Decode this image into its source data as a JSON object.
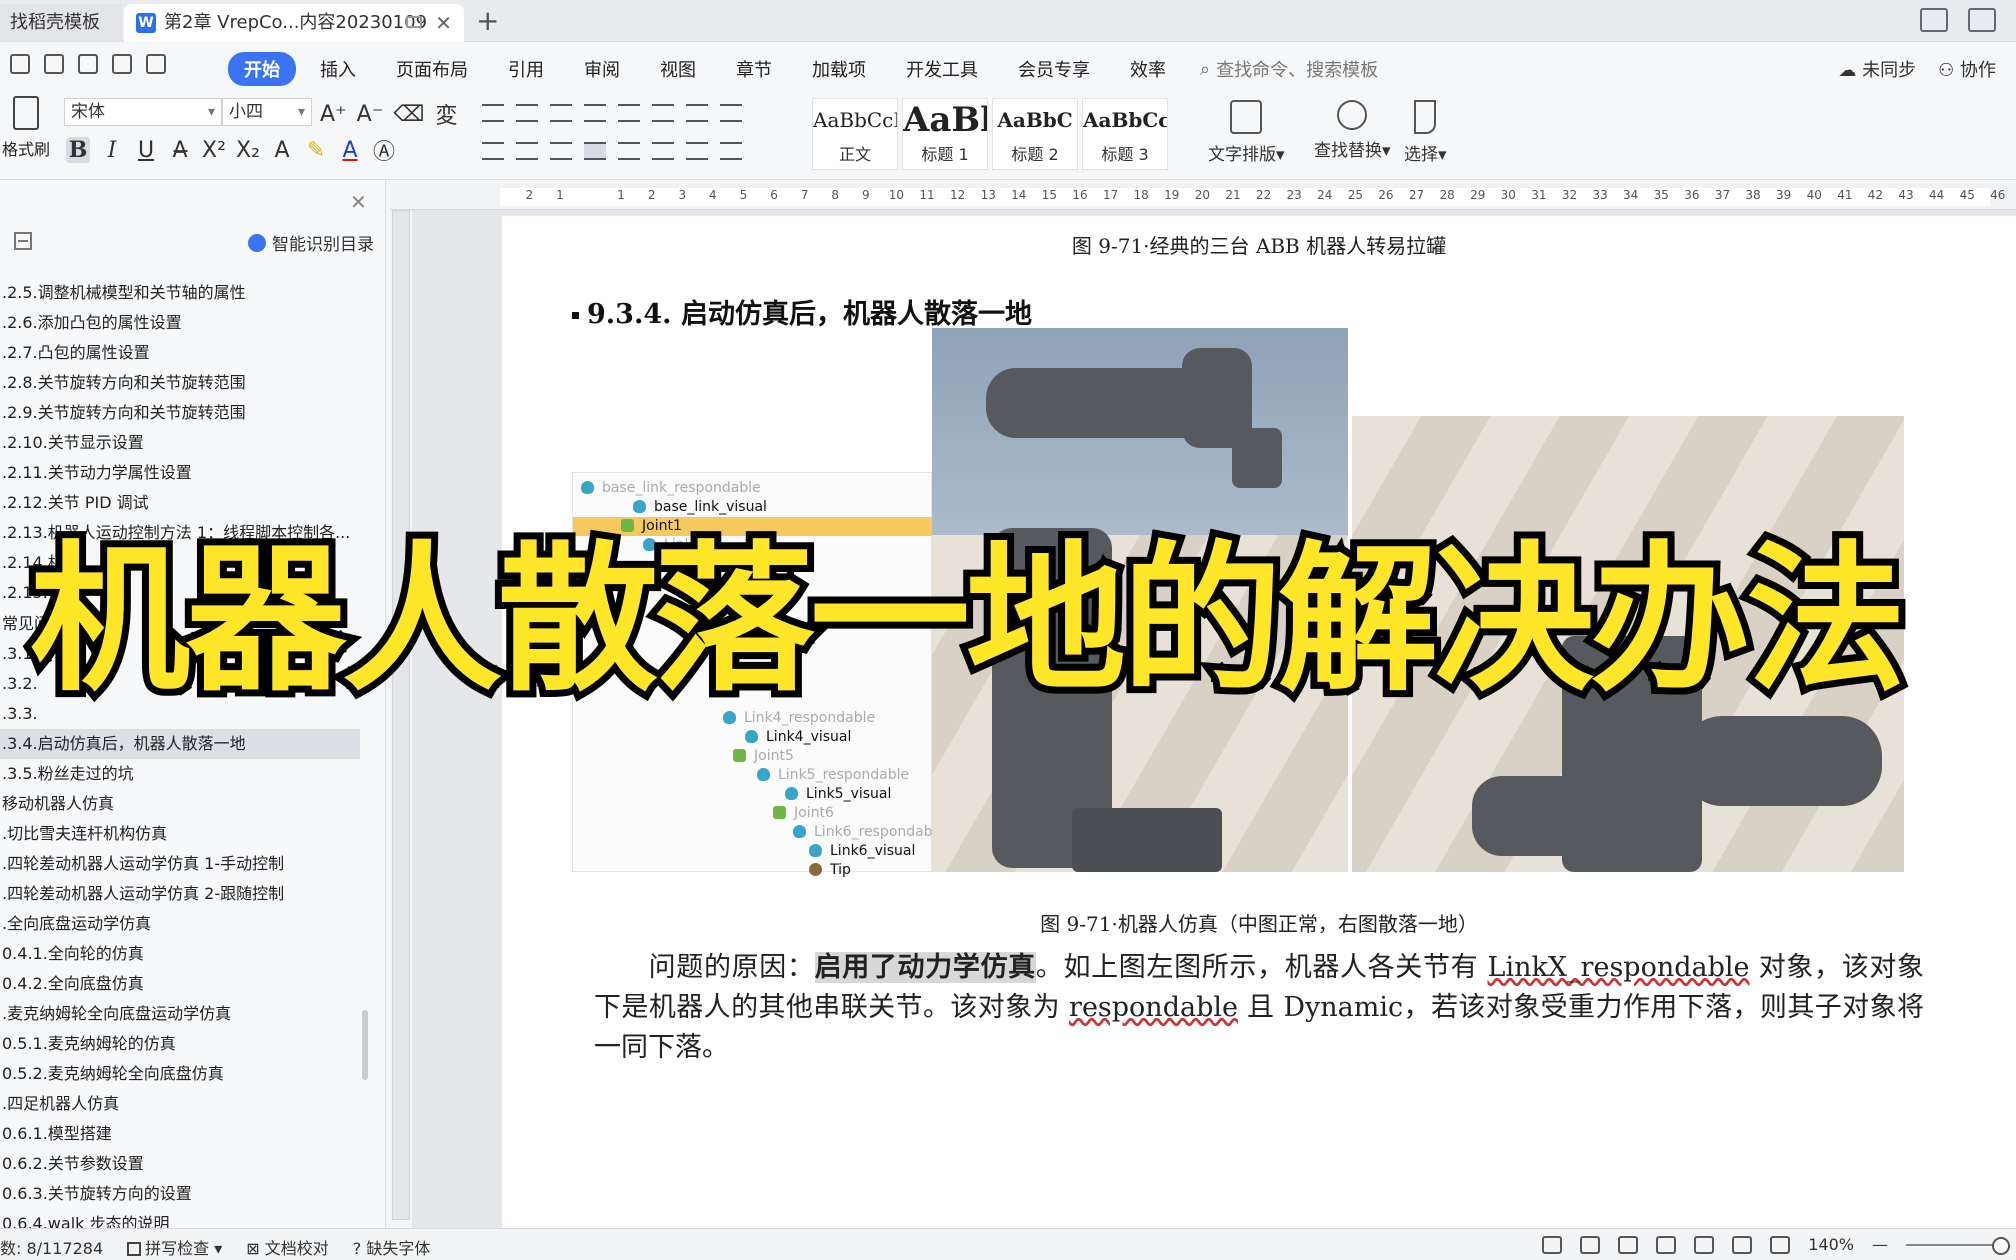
{
  "tabs": {
    "inactive_label": "找稻壳模板",
    "active_label": "第2章 VrepCo...内容20230109"
  },
  "menu": {
    "items": [
      "开始",
      "插入",
      "页面布局",
      "引用",
      "审阅",
      "视图",
      "章节",
      "加载项",
      "开发工具",
      "会员专享",
      "效率"
    ],
    "search_placeholder": "查找命令、搜索模板",
    "sync": "未同步",
    "collab": "协作"
  },
  "ribbon": {
    "format_painter": "格式刷",
    "font_name": "宋体",
    "font_size": "小四",
    "styles": [
      {
        "sample": "AaBbCcI",
        "label": "正文"
      },
      {
        "sample": "AaBl",
        "label": "标题 1"
      },
      {
        "sample": "AaBbC",
        "label": "标题 2"
      },
      {
        "sample": "AaBbCc",
        "label": "标题 3"
      }
    ],
    "text_layout": "文字排版",
    "find_replace": "查找替换",
    "select": "选择"
  },
  "toc": {
    "smart_toc": "智能识别目录",
    "items": [
      ".2.5.调整机械模型和关节轴的属性",
      ".2.6.添加凸包的属性设置",
      ".2.7.凸包的属性设置",
      ".2.8.关节旋转方向和关节旋转范围",
      ".2.9.关节旋转方向和关节旋转范围",
      ".2.10.关节显示设置",
      ".2.11.关节动力学属性设置",
      ".2.12.关节 PID 调试",
      ".2.13.机器人运动控制方法 1：线程脚本控制各...",
      ".2.14.机",
      ".2.15.",
      "常见问题",
      ".3.1.",
      ".3.2.",
      ".3.3.",
      ".3.4.启动仿真后，机器人散落一地",
      ".3.5.粉丝走过的坑",
      "移动机器人仿真",
      ".切比雪夫连杆机构仿真",
      ".四轮差动机器人运动学仿真 1-手动控制",
      ".四轮差动机器人运动学仿真 2-跟随控制",
      ".全向底盘运动学仿真",
      "0.4.1.全向轮的仿真",
      "0.4.2.全向底盘仿真",
      ".麦克纳姆轮全向底盘运动学仿真",
      "0.5.1.麦克纳姆轮的仿真",
      "0.5.2.麦克纳姆轮全向底盘仿真",
      ".四足机器人仿真",
      "0.6.1.模型搭建",
      "0.6.2.关节参数设置",
      "0.6.3.关节旋转方向的设置",
      "0.6.4.walk 步态的说明"
    ],
    "selected_index": 15
  },
  "ruler": {
    "ticks": [
      "2",
      "1",
      "",
      "1",
      "2",
      "3",
      "4",
      "5",
      "6",
      "7",
      "8",
      "9",
      "10",
      "11",
      "12",
      "13",
      "14",
      "15",
      "16",
      "17",
      "18",
      "19",
      "20",
      "21",
      "22",
      "23",
      "24",
      "25",
      "26",
      "27",
      "28",
      "29",
      "30",
      "31",
      "32",
      "33",
      "34",
      "35",
      "36",
      "37",
      "38",
      "39",
      "40",
      "41",
      "42",
      "43",
      "44",
      "45",
      "46"
    ]
  },
  "doc": {
    "caption_top": "图 9-71·经典的三台 ABB 机器人转易拉罐",
    "heading": "9.3.4.  启动仿真后，机器人散落一地",
    "caption_figure": "图 9-71·机器人仿真（中图正常，右图散落一地）",
    "para_prefix": "问题的原因：",
    "para_highlight": "启用了动力学仿真",
    "para_rest_1": "。如上图左图所示，机器人各关节有 ",
    "para_link1": "LinkX_respondable",
    "para_rest_2": " 对象，该对象下是机器人的其他串联关节。该对象为 ",
    "para_link2": "respondable",
    "para_rest_3": " 且 Dynamic，若该对象受重力作用下落，则其子对象将一同下落。"
  },
  "tree": [
    {
      "label": "base_link_respondable",
      "icon": "shape",
      "faded": true
    },
    {
      "label": "base_link_visual",
      "icon": "shape",
      "faded": false
    },
    {
      "label": "Joint1",
      "icon": "joint",
      "faded": false,
      "selected": true
    },
    {
      "label": "Link1",
      "icon": "shape",
      "faded": true
    },
    {
      "label": "Link4_respondable",
      "icon": "shape",
      "faded": true
    },
    {
      "label": "Link4_visual",
      "icon": "shape",
      "faded": false
    },
    {
      "label": "Joint5",
      "icon": "joint",
      "faded": true
    },
    {
      "label": "Link5_respondable",
      "icon": "shape",
      "faded": true
    },
    {
      "label": "Link5_visual",
      "icon": "shape",
      "faded": false
    },
    {
      "label": "Joint6",
      "icon": "joint",
      "faded": true
    },
    {
      "label": "Link6_respondable",
      "icon": "shape",
      "faded": true
    },
    {
      "label": "Link6_visual",
      "icon": "shape",
      "faded": false
    },
    {
      "label": "Tip",
      "icon": "dummy",
      "faded": false
    }
  ],
  "overlay_title": "机器人散落一地的解决办法",
  "status": {
    "wordcount": "数: 8/117284",
    "spellcheck": "拼写检查",
    "proofread": "文档校对",
    "missing_font": "缺失字体",
    "zoom": "140%"
  }
}
